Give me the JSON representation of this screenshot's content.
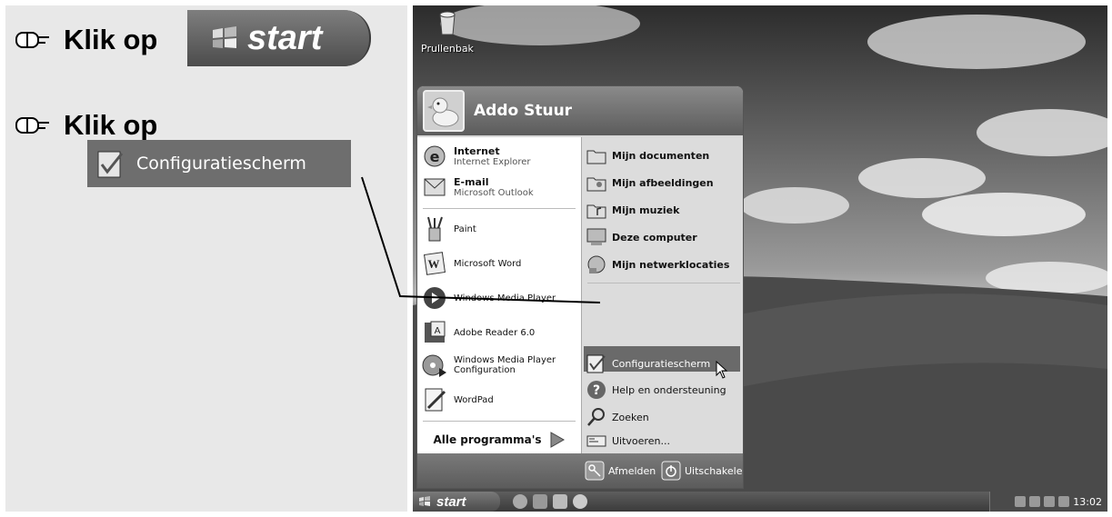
{
  "instructions": {
    "step1": {
      "text": "Klik op",
      "button_label": "start"
    },
    "step2": {
      "text": "Klik op",
      "item_label": "Configuratiescherm"
    }
  },
  "desktop": {
    "recycle_bin": "Prullenbak"
  },
  "start_menu": {
    "user": "Addo Stuur",
    "pinned": [
      {
        "title": "Internet",
        "subtitle": "Internet Explorer",
        "icon": "internet-explorer-icon"
      },
      {
        "title": "E-mail",
        "subtitle": "Microsoft Outlook",
        "icon": "outlook-icon"
      }
    ],
    "recent": [
      {
        "label": "Paint",
        "icon": "paint-icon"
      },
      {
        "label": "Microsoft Word",
        "icon": "word-icon"
      },
      {
        "label": "Windows Media Player",
        "icon": "media-player-icon"
      },
      {
        "label": "Adobe Reader 6.0",
        "icon": "adobe-reader-icon"
      },
      {
        "label": "Windows Media Player",
        "label2": "Configuration",
        "icon": "media-player-config-icon"
      },
      {
        "label": "WordPad",
        "icon": "wordpad-icon"
      }
    ],
    "all_programs": "Alle programma's",
    "right": [
      {
        "label": "Mijn documenten",
        "icon": "documents-folder-icon"
      },
      {
        "label": "Mijn afbeeldingen",
        "icon": "pictures-folder-icon"
      },
      {
        "label": "Mijn muziek",
        "icon": "music-folder-icon"
      },
      {
        "label": "Deze computer",
        "icon": "computer-icon"
      },
      {
        "label": "Mijn netwerklocaties",
        "icon": "network-icon"
      },
      {
        "label": "Configuratiescherm",
        "icon": "control-panel-icon"
      },
      {
        "label": "Help en ondersteuning",
        "icon": "help-icon"
      },
      {
        "label": "Zoeken",
        "icon": "search-icon"
      },
      {
        "label": "Uitvoeren...",
        "icon": "run-icon"
      }
    ],
    "footer": {
      "logoff": "Afmelden",
      "shutdown": "Uitschakelen"
    }
  },
  "taskbar": {
    "start": "start",
    "clock": "13:02"
  }
}
